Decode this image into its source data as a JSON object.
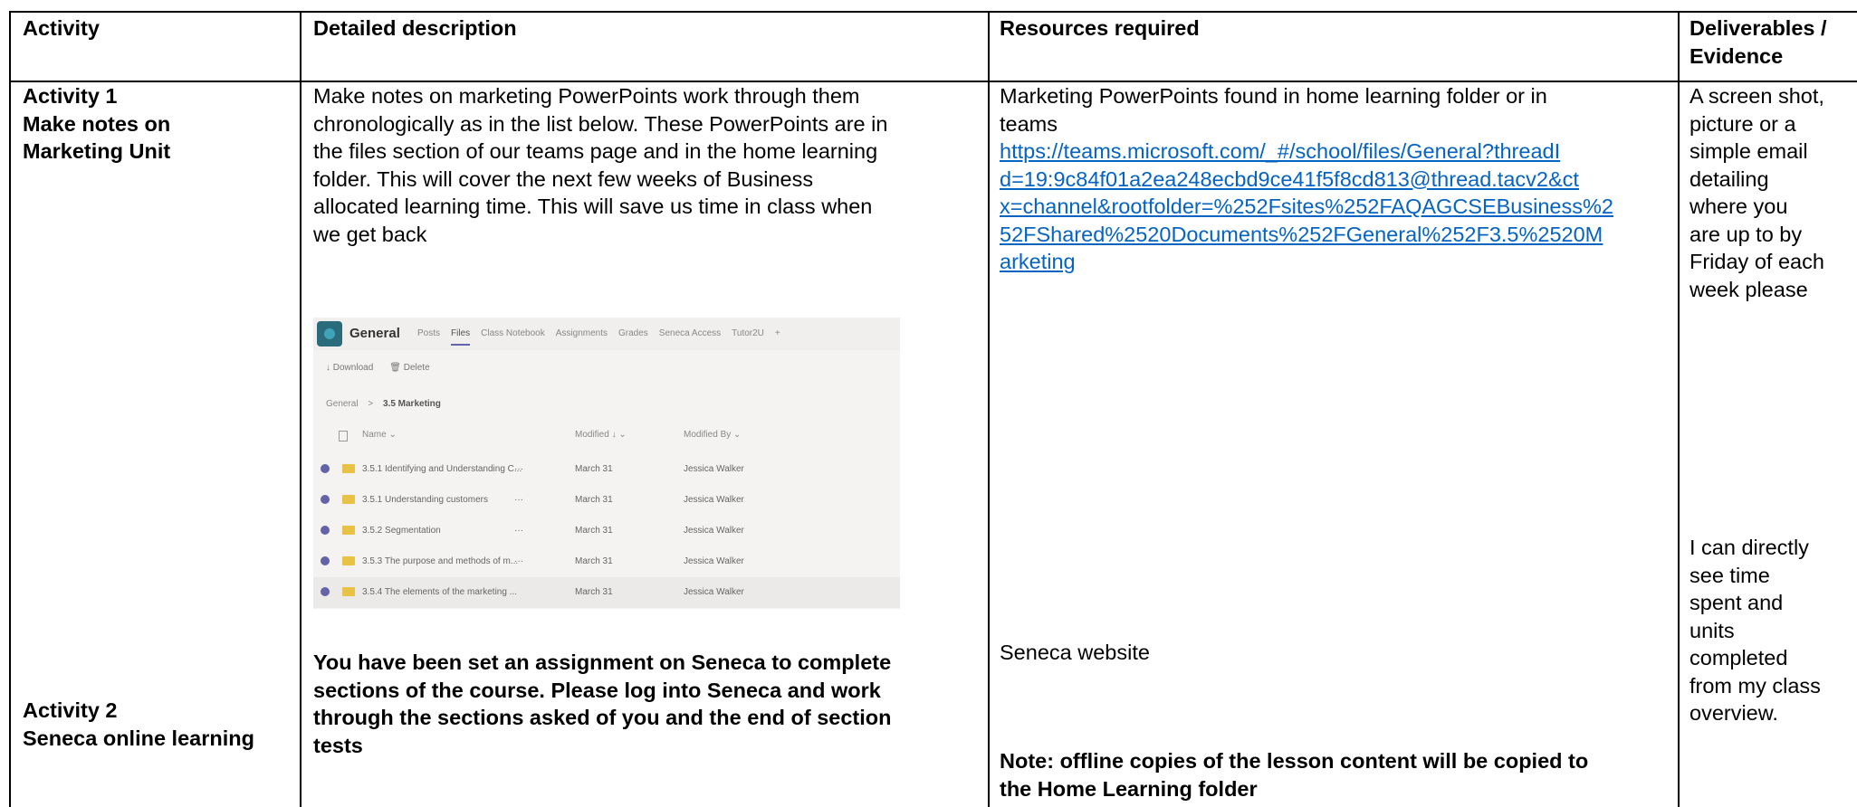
{
  "headers": {
    "activity": "Activity",
    "description": "Detailed description",
    "resources": "Resources required",
    "deliverables_line1": "Deliverables /",
    "deliverables_line2": "Evidence"
  },
  "activity1": {
    "line1": "Activity 1",
    "line2": "Make notes on",
    "line3": "Marketing Unit",
    "description": [
      "Make notes on marketing PowerPoints work through them",
      "chronologically as in the list below. These PowerPoints are in",
      "the files section of our teams page and in the home learning",
      "folder. This will cover the next few weeks of Business",
      "allocated learning time. This will save us time in class when",
      "we get back"
    ],
    "resources": [
      "Marketing PowerPoints found in home learning folder or in",
      "teams"
    ],
    "link_lines": [
      "https://teams.microsoft.com/_#/school/files/General?threadI",
      "d=19:9c84f01a2ea248ecbd9ce41f5f8cd813@thread.tacv2&ct",
      "x=channel&rootfolder=%252Fsites%252FAQAGCSEBusiness%2",
      "52FShared%2520Documents%252FGeneral%252F3.5%2520M",
      "arketing"
    ],
    "deliverables": [
      "A screen shot,",
      "picture or a",
      "simple email",
      "detailing",
      "where you",
      "are up to by",
      "Friday of each",
      "week please"
    ]
  },
  "teams_screenshot": {
    "team_name": "General",
    "tabs": [
      "Posts",
      "Files",
      "Class Notebook",
      "Assignments",
      "Grades",
      "Seneca Access",
      "Tutor2U",
      "+"
    ],
    "active_tab": "Files",
    "commands": [
      "↓ Download",
      "🗑 Delete"
    ],
    "breadcrumb_root": "General",
    "breadcrumb_sep": ">",
    "breadcrumb_current": "3.5 Marketing",
    "columns": [
      "Name ⌄",
      "Modified ↓ ⌄",
      "Modified By ⌄"
    ],
    "files": [
      {
        "name": "3.5.1 Identifying and Understanding C...",
        "modified": "March 31",
        "by": "Jessica Walker"
      },
      {
        "name": "3.5.1 Understanding customers",
        "modified": "March 31",
        "by": "Jessica Walker"
      },
      {
        "name": "3.5.2 Segmentation",
        "modified": "March 31",
        "by": "Jessica Walker"
      },
      {
        "name": "3.5.3 The purpose and methods of m...",
        "modified": "March 31",
        "by": "Jessica Walker"
      },
      {
        "name": "3.5.4 The elements of the marketing ...",
        "modified": "March 31",
        "by": "Jessica Walker"
      }
    ],
    "more_dots": "···"
  },
  "activity2": {
    "line1": "Activity 2",
    "line2": "Seneca online learning",
    "description": [
      "You have been set an assignment on Seneca to complete",
      "sections of the course. Please log into Seneca and work",
      "through the sections asked of you and the end of section",
      "tests"
    ],
    "resource": "Seneca website",
    "note": [
      "Note: offline copies of the lesson content will be copied to",
      "the Home Learning folder"
    ],
    "deliverables": [
      "I can directly",
      "see time",
      "spent and",
      "units",
      "completed",
      "from my class",
      "overview."
    ]
  },
  "colors": {
    "link": "#0563c1",
    "border": "#000000"
  }
}
